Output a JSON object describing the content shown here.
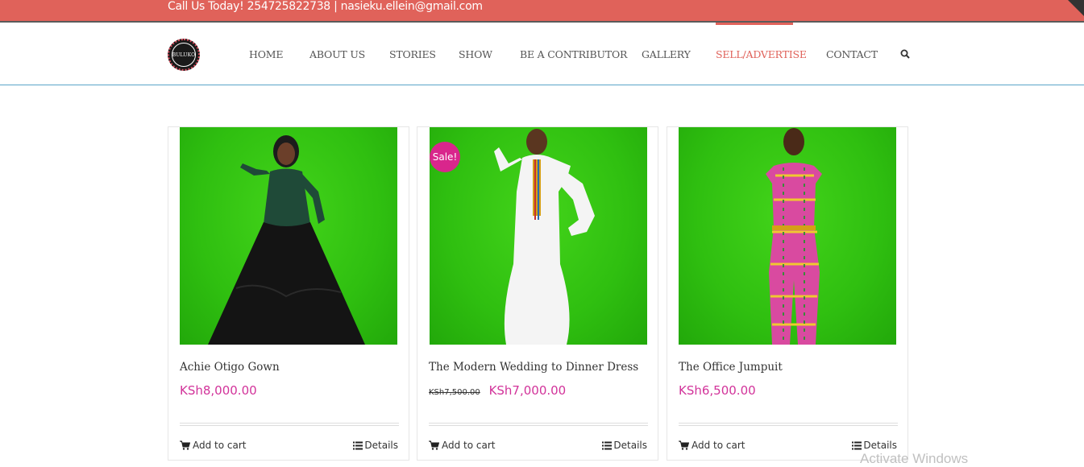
{
  "topbar": {
    "contact_text": "Call Us Today! 254725822738 | nasieku.ellein@gmail.com"
  },
  "brand": {
    "logo_text": "BULUKO"
  },
  "nav": {
    "items": [
      "HOME",
      "ABOUT US",
      "STORIES",
      "SHOW",
      "BE A CONTRIBUTOR",
      "GALLERY",
      "SELL/ADVERTISE",
      "CONTACT"
    ],
    "active": "SELL/ADVERTISE"
  },
  "products": [
    {
      "title": "Achie Otigo Gown",
      "price": "KSh8,000.00",
      "old_price": "",
      "sale": false,
      "add_to_cart": "Add to cart",
      "details": "Details"
    },
    {
      "title": "The Modern Wedding to Dinner Dress",
      "price": "KSh7,000.00",
      "old_price": "KSh7,500.00",
      "sale": true,
      "sale_label": "Sale!",
      "add_to_cart": "Add to cart",
      "details": "Details"
    },
    {
      "title": "The Office Jumpuit",
      "price": "KSh6,500.00",
      "old_price": "",
      "sale": false,
      "add_to_cart": "Add to cart",
      "details": "Details"
    }
  ],
  "watermark": "Activate Windows",
  "colors": {
    "accent": "#e0625a",
    "price": "#d2339a",
    "sale_badge": "#d9268c",
    "product_bg": "#34c214"
  },
  "icons": [
    "search-icon",
    "cart-icon",
    "list-icon"
  ]
}
